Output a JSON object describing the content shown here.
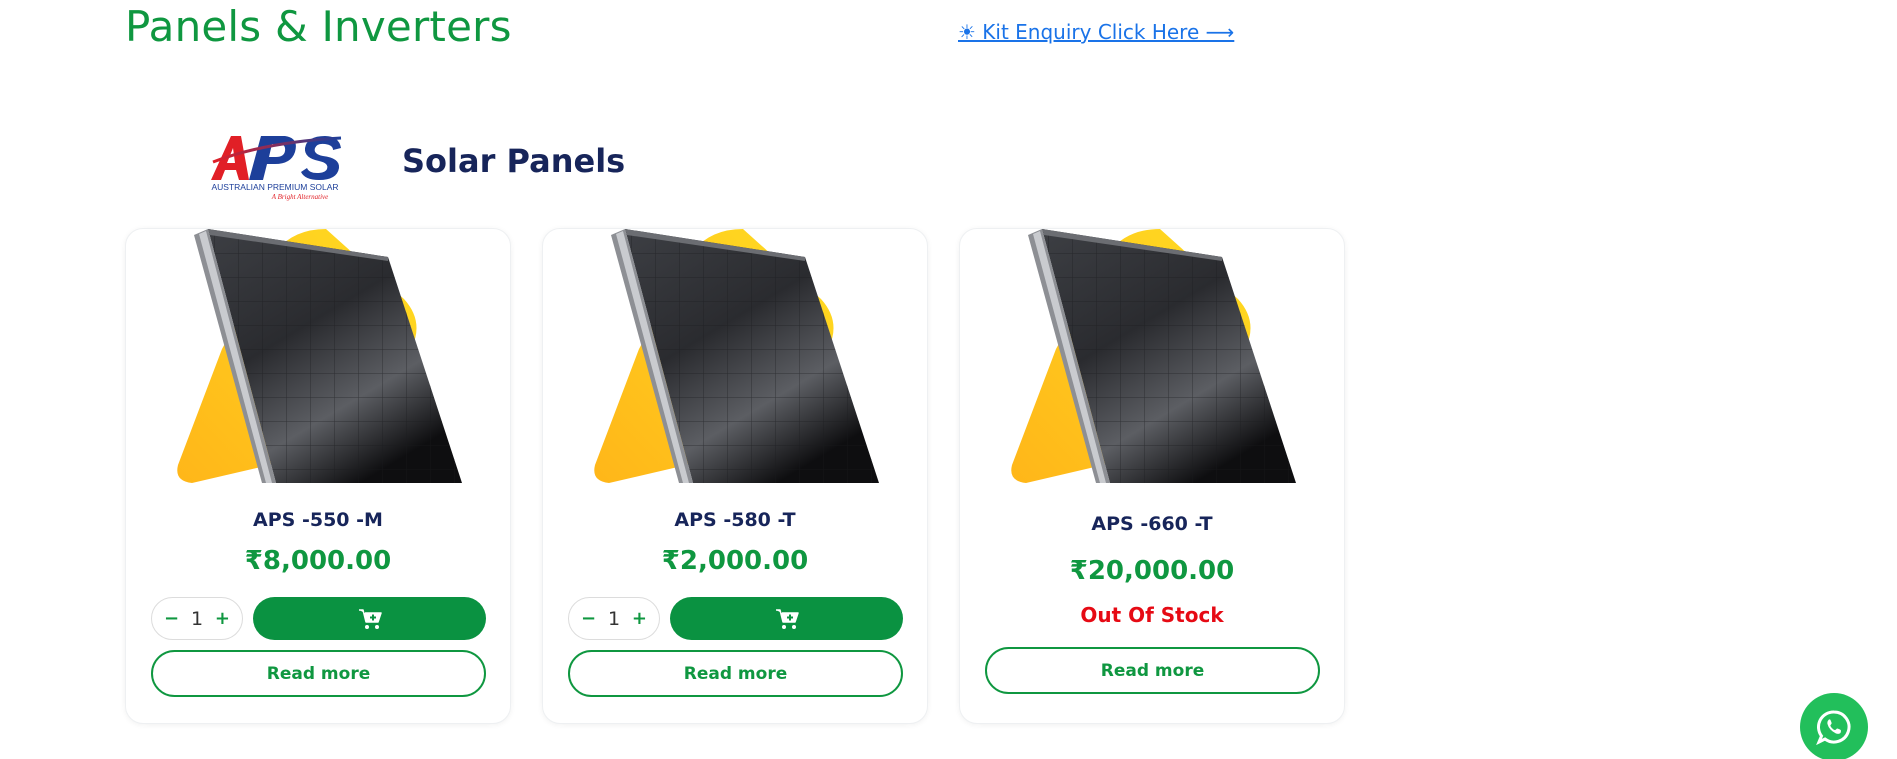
{
  "header": {
    "title": "Panels & Inverters",
    "kit_link": "☀ Kit Enquiry Click Here ⟶"
  },
  "brand": {
    "logo_text": "APS",
    "logo_subtitle": "AUSTRALIAN PREMIUM SOLAR",
    "logo_tagline": "A Bright Alternative"
  },
  "section": {
    "title": "Solar Panels"
  },
  "products": [
    {
      "name": "APS -550 -M",
      "price": "₹8,000.00",
      "quantity": "1",
      "qty_minus": "−",
      "qty_plus": "+",
      "read_more": "Read more"
    },
    {
      "name": "APS -580 -T",
      "price": "₹2,000.00",
      "quantity": "1",
      "qty_minus": "−",
      "qty_plus": "+",
      "read_more": "Read more"
    },
    {
      "name": "APS -660 -T",
      "price": "₹20,000.00",
      "stock": "Out Of Stock",
      "read_more": "Read more"
    }
  ],
  "colors": {
    "brand_green": "#0f9740",
    "navy": "#17255a",
    "accent_yellow": "#ffcc1a",
    "out_of_stock": "#e60a14",
    "link_blue": "#1a73e8",
    "whatsapp_green": "#22bf5b"
  },
  "icons": {
    "cart": "cart-plus-icon",
    "whatsapp": "whatsapp-icon"
  }
}
